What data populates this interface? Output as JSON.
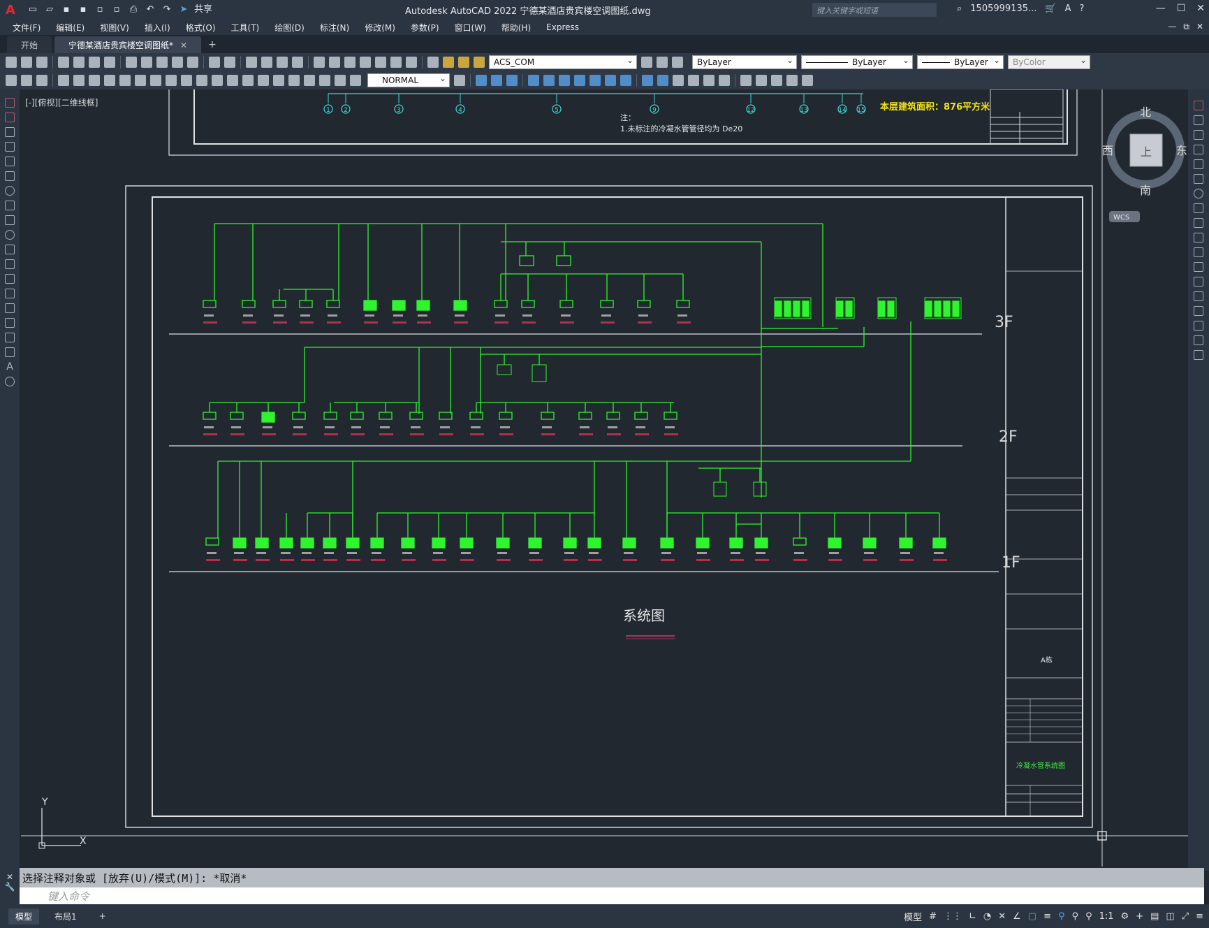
{
  "app": {
    "title": "Autodesk AutoCAD 2022    宁德某酒店贵宾楼空调图纸.dwg",
    "search_placeholder": "键入关键字或短语",
    "user": "1505999135...",
    "share_label": "共享"
  },
  "menu": [
    "文件(F)",
    "编辑(E)",
    "视图(V)",
    "插入(I)",
    "格式(O)",
    "工具(T)",
    "绘图(D)",
    "标注(N)",
    "修改(M)",
    "参数(P)",
    "窗口(W)",
    "帮助(H)",
    "Express"
  ],
  "tabs": [
    {
      "label": "开始"
    },
    {
      "label": "宁德某酒店贵宾楼空调图纸*"
    }
  ],
  "toolbar": {
    "layer": "ACS_COM",
    "color": "ByLayer",
    "linetype": "ByLayer",
    "lineweight": "ByLayer",
    "plotstyle": "ByColor",
    "dimstyle": "NORMAL"
  },
  "viewport": {
    "label": "[-][俯视][二维线框]",
    "wcs": "WCS",
    "cube": {
      "north": "北",
      "south": "南",
      "east": "东",
      "west": "西",
      "face": "上"
    }
  },
  "drawing": {
    "top_note": "注：",
    "top_note_line": "1.未标注的冷凝水管管径均为 De20",
    "area_note": "本层建筑面积：876平方米",
    "title": "系统图",
    "axes": [
      "1",
      "2",
      "3",
      "4",
      "5",
      "9",
      "12",
      "13",
      "14",
      "15"
    ],
    "floors": [
      "3F",
      "2F",
      "1F"
    ],
    "sheet_name": "冷凝水管系统图",
    "sheet_a": "A栋"
  },
  "command": {
    "history": "选择注释对象或 [放弃(U)/模式(M)]: *取消*",
    "placeholder": "键入命令"
  },
  "status": {
    "tabs": [
      "模型",
      "布局1"
    ],
    "model": "模型",
    "scale": "1:1"
  }
}
